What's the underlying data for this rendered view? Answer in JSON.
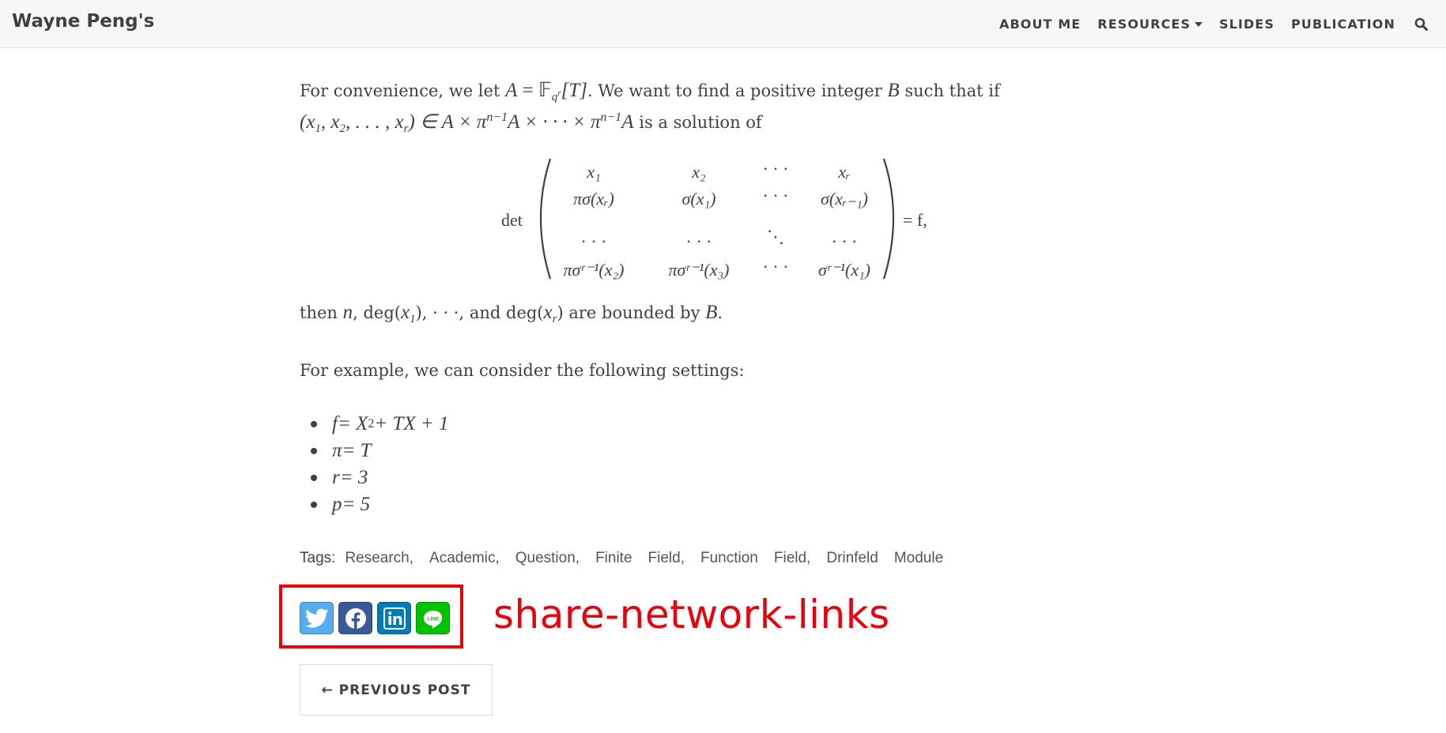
{
  "site": {
    "brand": "Wayne Peng's"
  },
  "nav": {
    "items": [
      "ABOUT ME",
      "RESOURCES",
      "SLIDES",
      "PUBLICATION"
    ],
    "search_icon": "search-icon"
  },
  "article": {
    "p1_line1": {
      "t1": "For convenience, we let ",
      "m1": "A",
      "m2": " = 𝔽",
      "sub_q": "q",
      "sub_r": "r",
      "m3": "[T]",
      "t2": ". We want to find a positive integer ",
      "m4": "B",
      "t3": " such that if"
    },
    "p1_line2": {
      "m1": "(x",
      "s1": "1",
      "m2": ", x",
      "s2": "2",
      "m3": ", . . . , x",
      "s3": "r",
      "m4": ") ∈ A × π",
      "p1": "n−1",
      "m5": "A × · · · × π",
      "p2": "n−1",
      "m6": "A",
      "t1": " is a solution of"
    },
    "matrix": {
      "det": "det",
      "rows": [
        [
          "x₁",
          "x₂",
          "· · ·",
          "xᵣ"
        ],
        [
          "πσ(xᵣ)",
          "σ(x₁)",
          "· · ·",
          "σ(xᵣ₋₁)"
        ],
        [
          "· · ·",
          "· · ·",
          "⋱",
          "· · ·"
        ],
        [
          "πσʳ⁻¹(x₂)",
          "πσʳ⁻¹(x₃)",
          "· · ·",
          "σʳ⁻¹(x₁)"
        ]
      ],
      "rhs": "= f,"
    },
    "p2": {
      "t1": "then ",
      "m1": "n",
      "t2": ", deg(",
      "m2": "x",
      "s2": "1",
      "t3": "), · · ·, and deg(",
      "m3": "x",
      "s3": "r",
      "t4": ") are bounded by ",
      "m4": "B",
      "t5": "."
    },
    "p3": "For example, we can consider the following settings:",
    "settings": [
      {
        "a": "f",
        "b": " = X",
        "sup": "2",
        "c": " + TX + 1"
      },
      {
        "a": "π",
        "b": " = T",
        "sup": "",
        "c": ""
      },
      {
        "a": "r",
        "b": " = 3",
        "sup": "",
        "c": ""
      },
      {
        "a": "p",
        "b": " = 5",
        "sup": "",
        "c": ""
      }
    ],
    "tags_label": "Tags:",
    "tags": [
      "Research,",
      "Academic,",
      "Question,",
      "Finite",
      "Field,",
      "Function",
      "Field,",
      "Drinfeld",
      "Module"
    ]
  },
  "share": {
    "annotation": "share-network-links",
    "buttons": [
      {
        "name": "twitter",
        "color": "#55acee"
      },
      {
        "name": "facebook",
        "color": "#3b5998"
      },
      {
        "name": "linkedin",
        "color": "#007bb5"
      },
      {
        "name": "line",
        "color": "#00c300"
      }
    ]
  },
  "pager": {
    "previous": "← PREVIOUS POST"
  }
}
